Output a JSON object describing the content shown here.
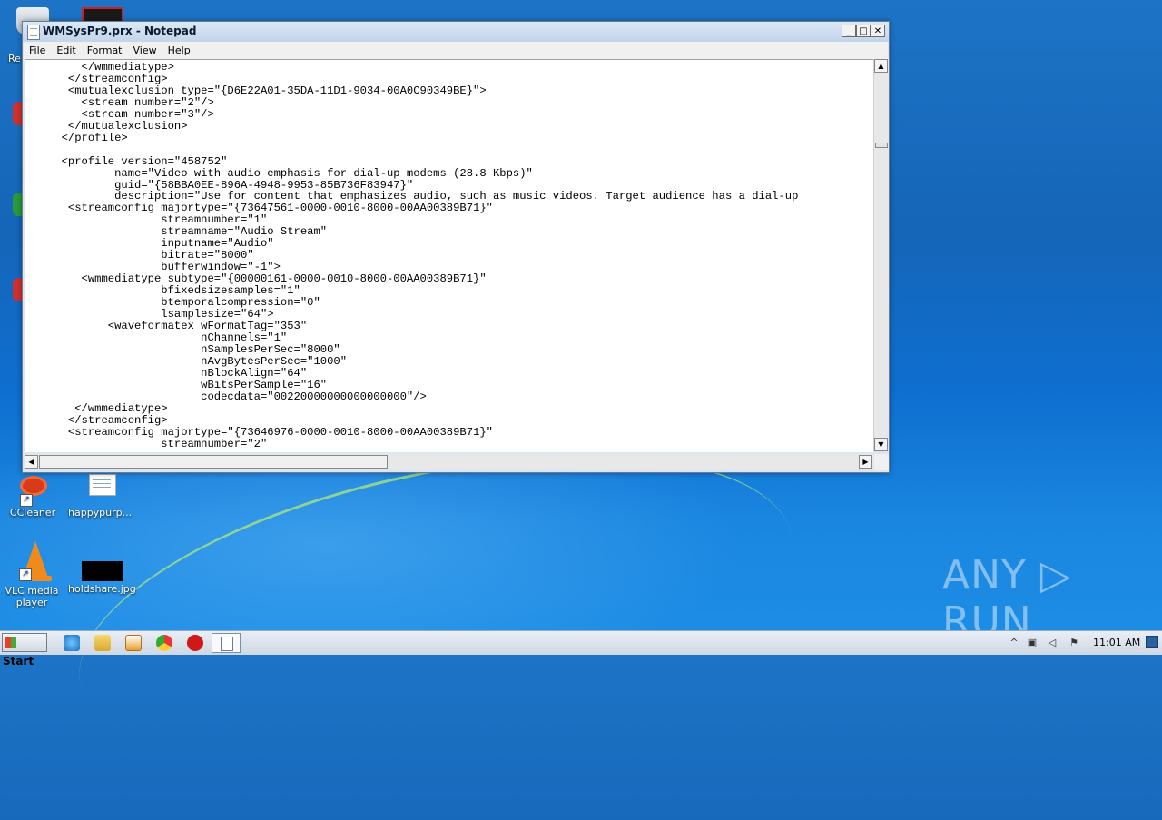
{
  "window": {
    "title": "WMSysPr9.prx - Notepad",
    "minimize": "_",
    "maximize": "□",
    "close": "✕"
  },
  "menu": [
    "File",
    "Edit",
    "Format",
    "View",
    "Help"
  ],
  "editor_lines": [
    "        </wmmediatype>",
    "      </streamconfig>",
    "      <mutualexclusion type=\"{D6E22A01-35DA-11D1-9034-00A0C90349BE}\">",
    "        <stream number=\"2\"/>",
    "        <stream number=\"3\"/>",
    "      </mutualexclusion>",
    "     </profile>",
    "",
    "     <profile version=\"458752\"",
    "             name=\"Video with audio emphasis for dial-up modems (28.8 Kbps)\"",
    "             guid=\"{58BBA0EE-896A-4948-9953-85B736F83947}\"",
    "             description=\"Use for content that emphasizes audio, such as music videos. Target audience has a dial-up",
    "      <streamconfig majortype=\"{73647561-0000-0010-8000-00AA00389B71}\"",
    "                    streamnumber=\"1\"",
    "                    streamname=\"Audio Stream\"",
    "                    inputname=\"Audio\"",
    "                    bitrate=\"8000\"",
    "                    bufferwindow=\"-1\">",
    "        <wmmediatype subtype=\"{00000161-0000-0010-8000-00AA00389B71}\"",
    "                    bfixedsizesamples=\"1\"",
    "                    btemporalcompression=\"0\"",
    "                    lsamplesize=\"64\">",
    "            <waveformatex wFormatTag=\"353\"",
    "                          nChannels=\"1\"",
    "                          nSamplesPerSec=\"8000\"",
    "                          nAvgBytesPerSec=\"1000\"",
    "                          nBlockAlign=\"64\"",
    "                          wBitsPerSample=\"16\"",
    "                          codecdata=\"00220000000000000000\"/>",
    "       </wmmediatype>",
    "      </streamconfig>",
    "      <streamconfig majortype=\"{73646976-0000-0010-8000-00AA00389B71}\"",
    "                    streamnumber=\"2\""
  ],
  "desktop_icons": [
    {
      "label": "CCleaner",
      "icon": "ccleaner-icon"
    },
    {
      "label": "happypurp...",
      "icon": "document-icon"
    },
    {
      "label": "VLC media player",
      "icon": "vlc-cone-icon"
    },
    {
      "label": "holdshare.jpg",
      "icon": "image-file-icon"
    }
  ],
  "taskbar": {
    "start_label": "Start",
    "clock": "11:01 AM",
    "pinned": [
      "internet-explorer-icon",
      "explorer-folder-icon",
      "media-player-icon",
      "chrome-icon",
      "opera-icon",
      "notepad-icon"
    ]
  },
  "watermark": "ANY ▷ RUN"
}
